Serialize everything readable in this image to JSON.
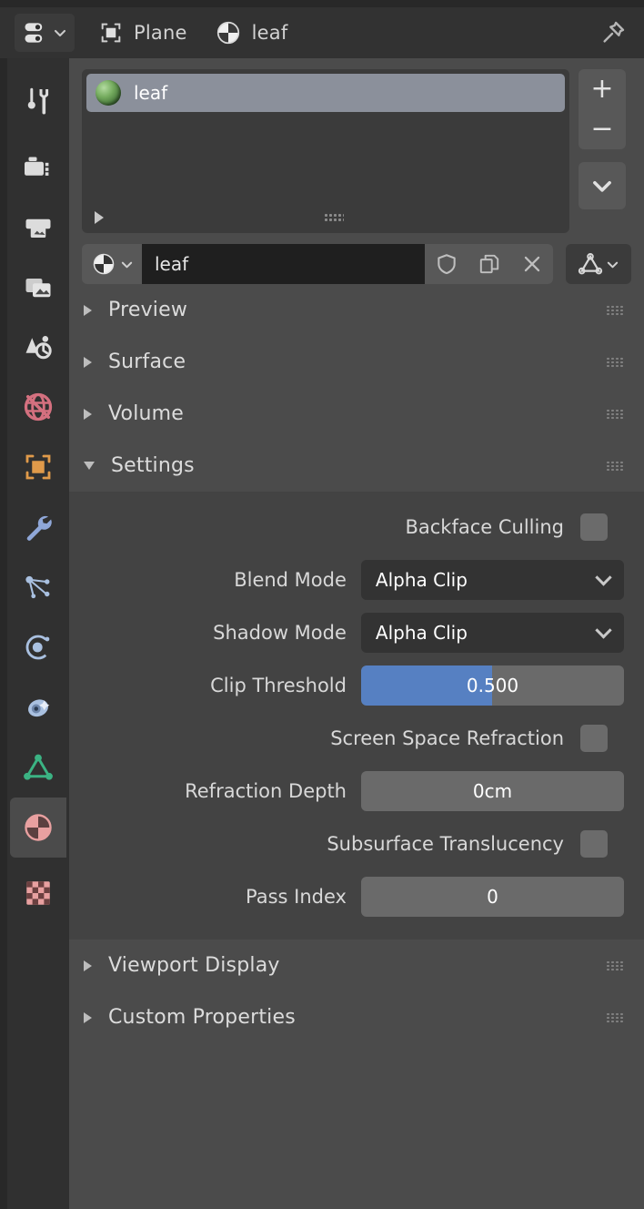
{
  "header": {
    "editor_type_icon": "properties-editor-icon",
    "editor_type_chevron": "chevron-down-icon",
    "breadcrumb": [
      {
        "icon": "object-data-plane-icon",
        "label": "Plane"
      },
      {
        "icon": "material-sphere-icon",
        "label": "leaf"
      }
    ],
    "pin_icon": "pin-icon"
  },
  "tabs": [
    {
      "name": "tool",
      "icon": "tool-screwdriver-wrench-icon",
      "active": false
    },
    {
      "name": "render",
      "icon": "render-camera-icon",
      "active": false
    },
    {
      "name": "output",
      "icon": "output-printer-icon",
      "active": false
    },
    {
      "name": "view-layer",
      "icon": "view-layer-images-icon",
      "active": false
    },
    {
      "name": "scene",
      "icon": "scene-cone-sphere-icon",
      "active": false
    },
    {
      "name": "world",
      "icon": "world-globe-icon",
      "active": false
    },
    {
      "name": "object",
      "icon": "object-square-icon",
      "active": false
    },
    {
      "name": "modifiers",
      "icon": "modifier-wrench-icon",
      "active": false
    },
    {
      "name": "particles",
      "icon": "particles-icon",
      "active": false
    },
    {
      "name": "physics",
      "icon": "physics-orbit-icon",
      "active": false
    },
    {
      "name": "object-constraints",
      "icon": "constraints-clamp-icon",
      "active": false
    },
    {
      "name": "object-data",
      "icon": "object-data-triangle-icon",
      "active": false
    },
    {
      "name": "material",
      "icon": "material-sphere-icon",
      "active": true
    },
    {
      "name": "texture",
      "icon": "texture-checker-icon",
      "active": false
    }
  ],
  "slot_list": {
    "items": [
      {
        "name": "leaf",
        "selected": true,
        "preview_icon": "material-preview-sphere-icon"
      }
    ],
    "footer": {
      "expand_icon": "expand-triangle-icon",
      "grip_icon": "grip-dots-icon"
    },
    "buttons": [
      {
        "name": "add-material-slot",
        "label": "+"
      },
      {
        "name": "remove-material-slot",
        "label": "−"
      },
      {
        "name": "material-specials-menu",
        "label": "chevron-down-icon"
      }
    ]
  },
  "datablock": {
    "browse_icon": "material-sphere-icon",
    "browse_chevron": "chevron-down-icon",
    "name_value": "leaf",
    "name_placeholder": "Name",
    "buttons": [
      {
        "name": "fake-user",
        "icon": "shield-icon"
      },
      {
        "name": "new-material-copy",
        "icon": "copy-pages-icon"
      },
      {
        "name": "unlink-material",
        "icon": "close-x-icon"
      }
    ],
    "mesh_data_icon": "object-data-triangle-icon",
    "mesh_data_chevron": "chevron-down-icon"
  },
  "panels": [
    {
      "name": "preview",
      "label": "Preview",
      "open": false
    },
    {
      "name": "surface",
      "label": "Surface",
      "open": false
    },
    {
      "name": "volume",
      "label": "Volume",
      "open": false
    },
    {
      "name": "settings",
      "label": "Settings",
      "open": true
    }
  ],
  "bottom_panels": [
    {
      "name": "viewport-display",
      "label": "Viewport Display",
      "open": false
    },
    {
      "name": "custom-properties",
      "label": "Custom Properties",
      "open": false
    }
  ],
  "settings": {
    "backface_culling": {
      "label": "Backface Culling",
      "checked": false
    },
    "blend_mode": {
      "label": "Blend Mode",
      "value": "Alpha Clip"
    },
    "shadow_mode": {
      "label": "Shadow Mode",
      "value": "Alpha Clip"
    },
    "clip_threshold": {
      "label": "Clip Threshold",
      "value": "0.500",
      "fill_percent": 50
    },
    "screen_space_refraction": {
      "label": "Screen Space Refraction",
      "checked": false
    },
    "refraction_depth": {
      "label": "Refraction Depth",
      "value": "0cm"
    },
    "subsurface_translucency": {
      "label": "Subsurface Translucency",
      "checked": false
    },
    "pass_index": {
      "label": "Pass Index",
      "value": "0"
    }
  },
  "colors": {
    "panel_bg": "#4b4b4b",
    "settings_bg": "#434343",
    "tabcol_bg": "#303030",
    "header_bg": "#323232",
    "slider_fill": "#5680c2",
    "selected_row": "#8b909b",
    "field_value_bg": "#6a6a6a",
    "dropdown_bg": "#333333",
    "text": "#dcdcdc"
  }
}
